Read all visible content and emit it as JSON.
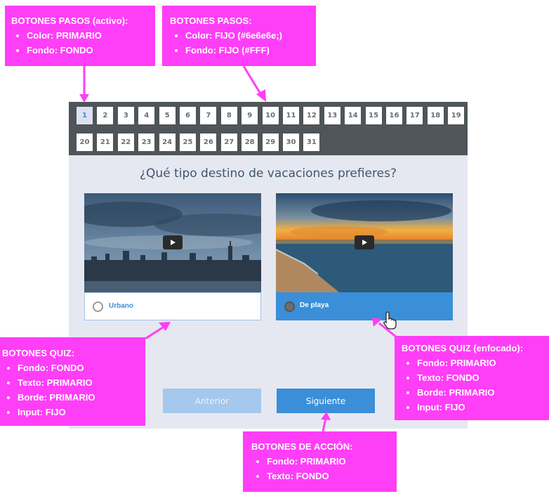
{
  "steps": [
    "1",
    "2",
    "3",
    "4",
    "5",
    "6",
    "7",
    "8",
    "9",
    "10",
    "11",
    "12",
    "13",
    "14",
    "15",
    "16",
    "17",
    "18",
    "19",
    "20",
    "21",
    "22",
    "23",
    "24",
    "25",
    "26",
    "27",
    "28",
    "29",
    "30",
    "31"
  ],
  "question": "¿Qué tipo destino de vacaciones prefieres?",
  "options": [
    {
      "label": "Urbano",
      "image": "city-skyline-video",
      "play_icon": "play-icon"
    },
    {
      "label": "De playa",
      "image": "beach-sunset-video",
      "play_icon": "play-icon"
    }
  ],
  "actions": {
    "prev": "Anterior",
    "next": "Siguiente"
  },
  "annotations": {
    "steps_active": {
      "title": "BOTONES PASOS  (activo):",
      "items": [
        "Color: PRIMARIO",
        "Fondo: FONDO"
      ]
    },
    "steps": {
      "title": "BOTONES PASOS:",
      "items": [
        "Color: FIJO (#6e6e6e;)",
        "Fondo: FIJO (#FFF)"
      ]
    },
    "quiz": {
      "title": "BOTONES QUIZ:",
      "items": [
        "Fondo: FONDO",
        "Texto:  PRIMARIO",
        "Borde: PRIMARIO",
        "Input: FIJO"
      ]
    },
    "quiz_focus": {
      "title": "BOTONES QUIZ (enfocado):",
      "items": [
        "Fondo: PRIMARIO",
        "Texto: FONDO",
        "Borde: PRIMARIO",
        "Input: FIJO"
      ]
    },
    "action": {
      "title": "BOTONES DE ACCIÓN:",
      "items": [
        "Fondo: PRIMARIO",
        "Texto: FONDO"
      ]
    }
  },
  "colors": {
    "primary": "#3a8fd8",
    "background": "#e6e8f1",
    "step_text": "#6e6e6e",
    "annotation": "#ff3ef7",
    "header": "#4f5558"
  }
}
